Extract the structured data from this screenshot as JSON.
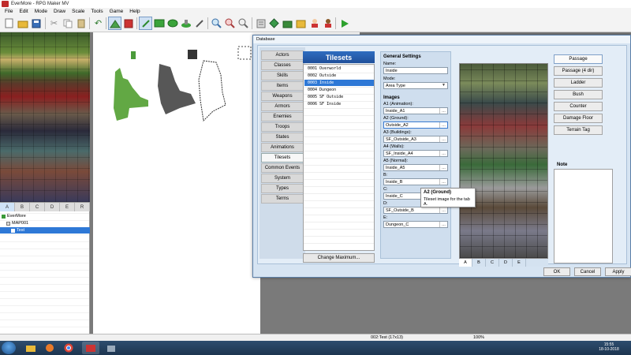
{
  "window": {
    "title": "EverMore - RPG Maker MV"
  },
  "menu": [
    "File",
    "Edit",
    "Mode",
    "Draw",
    "Scale",
    "Tools",
    "Game",
    "Help"
  ],
  "toolbar_icons": [
    "new-icon",
    "open-icon",
    "save-icon",
    "cut-icon",
    "copy-icon",
    "paste-icon",
    "undo-icon",
    "map-mode-icon",
    "event-mode-icon",
    "pencil-icon",
    "rectangle-icon",
    "ellipse-icon",
    "fill-icon",
    "shadow-pen-icon",
    "zoom-in-icon",
    "zoom-out-icon",
    "zoom-actual-icon",
    "database-icon",
    "plugin-manager-icon",
    "sound-test-icon",
    "event-searcher-icon",
    "character-generator-icon",
    "resource-manager-icon",
    "playtest-icon"
  ],
  "tile_tabs": [
    "A",
    "B",
    "C",
    "D",
    "E",
    "R"
  ],
  "map_tree": {
    "project": "EverMore",
    "map": "MAP001",
    "selected": "Test"
  },
  "status": {
    "map": "002:Test (17x13)",
    "zoom": "100%"
  },
  "taskbar": {
    "time": "15:55",
    "date": "18-10-2018"
  },
  "dialog": {
    "title": "Database",
    "nav": [
      "Actors",
      "Classes",
      "Skills",
      "Items",
      "Weapons",
      "Armors",
      "Enemies",
      "Troops",
      "States",
      "Animations",
      "Tilesets",
      "Common Events",
      "System",
      "Types",
      "Terms"
    ],
    "nav_active": "Tilesets",
    "list_header": "Tilesets",
    "tilesets": [
      "0001 Overworld",
      "0002 Outside",
      "0003 Inside",
      "0004 Dungeon",
      "0005 SF Outside",
      "0006 SF Inside"
    ],
    "selected_tileset": "0003 Inside",
    "change_max": "Change Maximum...",
    "general": {
      "heading": "General Settings",
      "name_label": "Name:",
      "name_value": "Inside",
      "mode_label": "Mode:",
      "mode_value": "Area Type"
    },
    "images": {
      "heading": "Images",
      "fields": [
        {
          "label": "A1 (Animation):",
          "value": "Inside_A1"
        },
        {
          "label": "A2 (Ground):",
          "value": "Outside_A2"
        },
        {
          "label": "A3 (Buildings):",
          "value": "SF_Outside_A3"
        },
        {
          "label": "A4 (Walls):",
          "value": "SF_Inside_A4"
        },
        {
          "label": "A5 (Normal):",
          "value": "Inside_A5"
        },
        {
          "label": "B:",
          "value": "Inside_B"
        },
        {
          "label": "C:",
          "value": "Inside_C"
        },
        {
          "label": "D:",
          "value": "SF_Outside_B"
        },
        {
          "label": "E:",
          "value": "Dungeon_C"
        }
      ]
    },
    "tooltip": {
      "title": "A2 (Ground)",
      "text": "Tileset image for the tab A."
    },
    "preview_tabs": [
      "A",
      "B",
      "C",
      "D",
      "E"
    ],
    "passage_buttons": [
      "Passage",
      "Passage (4 dir)",
      "Ladder",
      "Bush",
      "Counter",
      "Damage Floor",
      "Terrain Tag"
    ],
    "note_label": "Note",
    "buttons": {
      "ok": "OK",
      "cancel": "Cancel",
      "apply": "Apply"
    }
  }
}
